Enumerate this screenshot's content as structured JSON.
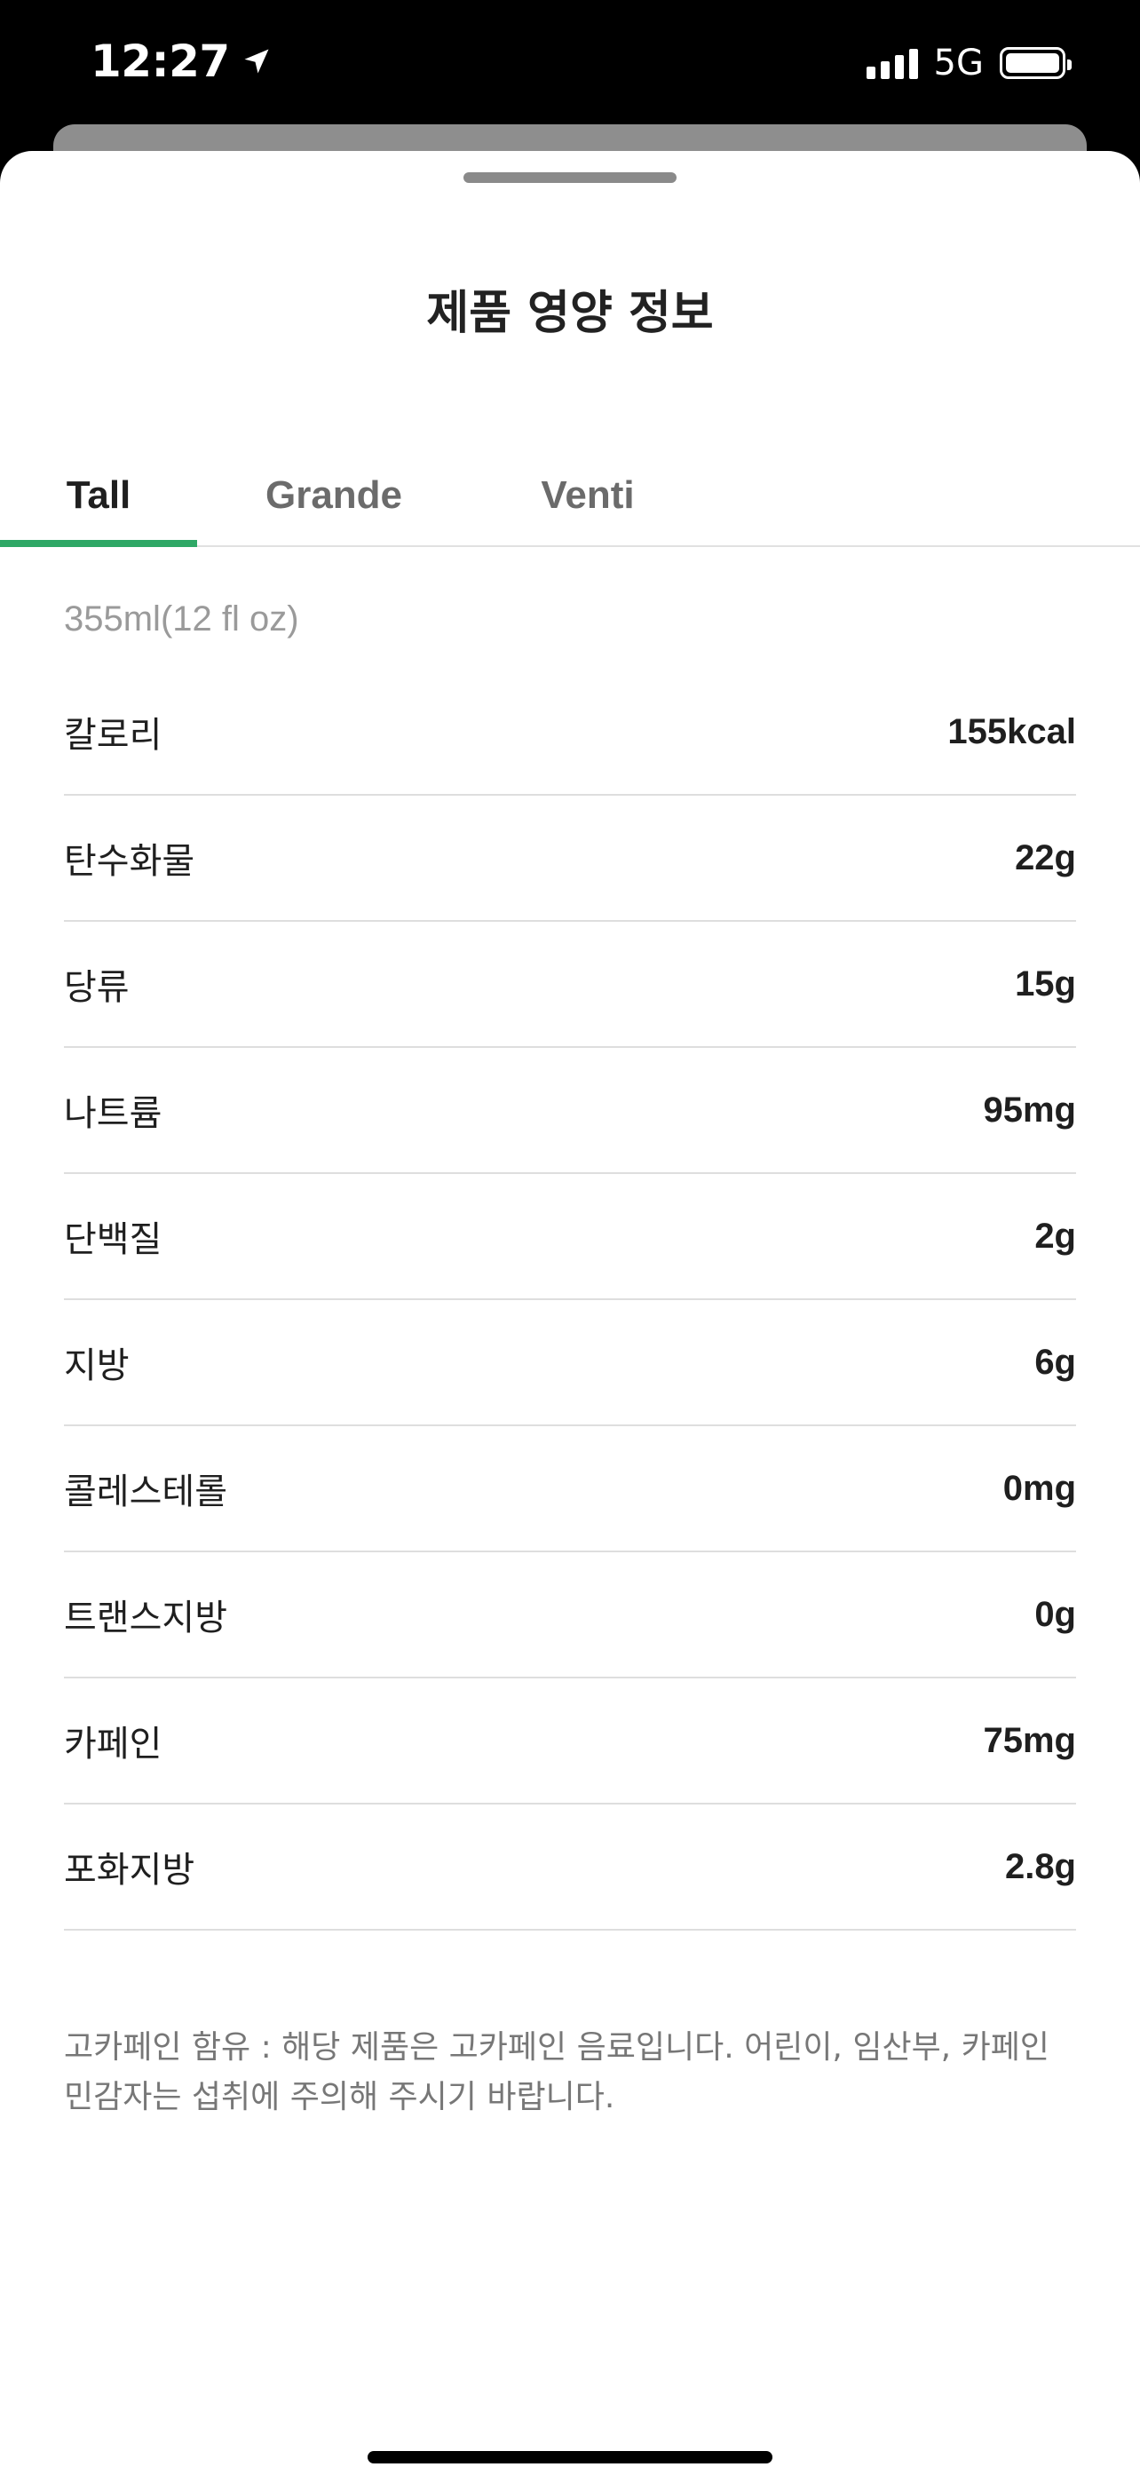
{
  "status_bar": {
    "time": "12:27",
    "network": "5G",
    "icons": [
      "location-arrow-icon",
      "signal-bars-icon",
      "battery-icon"
    ]
  },
  "sheet": {
    "title": "제품 영양 정보",
    "tabs": [
      {
        "label": "Tall",
        "active": true
      },
      {
        "label": "Grande",
        "active": false
      },
      {
        "label": "Venti",
        "active": false
      }
    ],
    "accent_color": "#2fa866",
    "size_info": "355ml(12 fl oz)",
    "nutrition": [
      {
        "label": "칼로리",
        "value": "155kcal"
      },
      {
        "label": "탄수화물",
        "value": "22g"
      },
      {
        "label": "당류",
        "value": "15g"
      },
      {
        "label": "나트륨",
        "value": "95mg"
      },
      {
        "label": "단백질",
        "value": "2g"
      },
      {
        "label": "지방",
        "value": "6g"
      },
      {
        "label": "콜레스테롤",
        "value": "0mg"
      },
      {
        "label": "트랜스지방",
        "value": "0g"
      },
      {
        "label": "카페인",
        "value": "75mg"
      },
      {
        "label": "포화지방",
        "value": "2.8g"
      }
    ],
    "notice_line1": "고카페인 함유 : 해당 제품은 고카페인 음료입니다. 어린이, 임산부, 카페인",
    "notice_line2": "민감자는 섭취에 주의해 주시기 바랍니다."
  }
}
